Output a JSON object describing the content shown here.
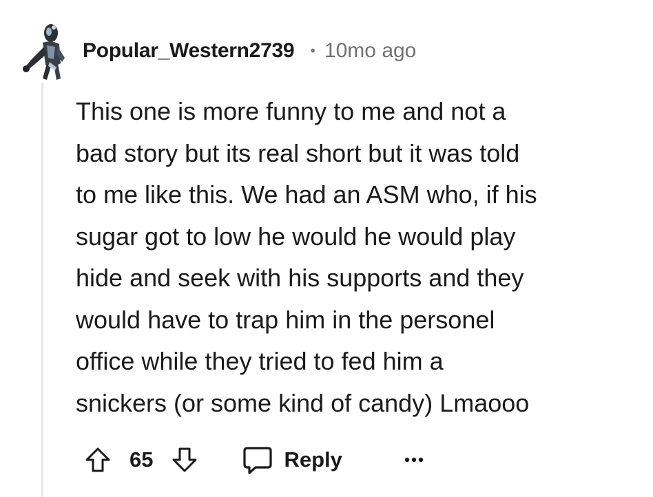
{
  "comment": {
    "author": "Popular_Western2739",
    "separator": "•",
    "timestamp": "10mo ago",
    "body_lines": [
      "This one is more funny to me and not a",
      "bad story but its real short but it was told",
      "to me like this. We had an ASM who, if his",
      "sugar got to low he would he would play",
      "hide and seek with his supports and they",
      "would have to trap him in the personel",
      "office while they tried to fed him a",
      "snickers (or some kind of candy) Lmaooo"
    ],
    "score": "65",
    "reply_label": "Reply"
  },
  "icons": {
    "upvote": "arrow-up-outline-icon",
    "downvote": "arrow-down-outline-icon",
    "reply": "speech-bubble-icon",
    "more": "ellipsis-icon",
    "avatar": "user-avatar"
  },
  "colors": {
    "text": "#1a1a1b",
    "meta": "#6f7173",
    "thread_line": "#e5e7ea"
  }
}
